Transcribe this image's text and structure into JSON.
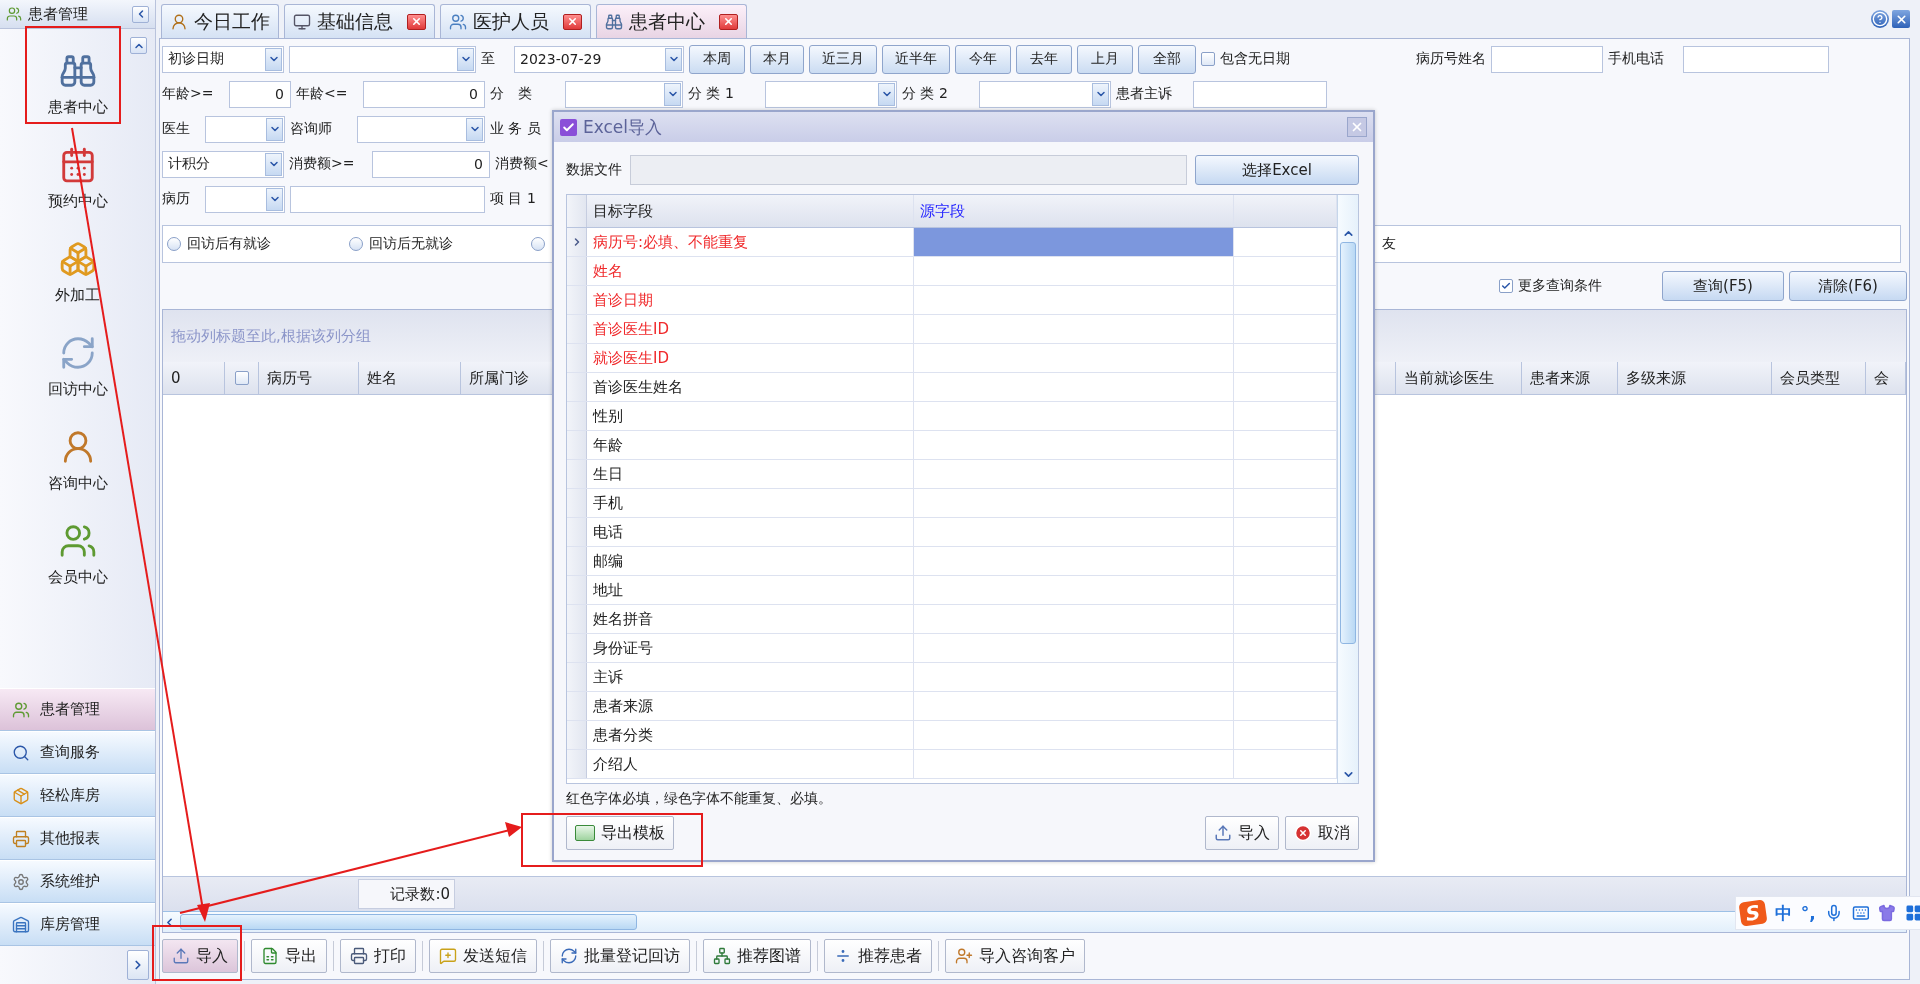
{
  "sidebar": {
    "title": "患者管理",
    "items": [
      {
        "label": "患者中心"
      },
      {
        "label": "预约中心"
      },
      {
        "label": "外加工"
      },
      {
        "label": "回访中心"
      },
      {
        "label": "咨询中心"
      },
      {
        "label": "会员中心"
      }
    ],
    "nav": [
      {
        "label": "患者管理",
        "selected": true
      },
      {
        "label": "查询服务",
        "selected": false
      },
      {
        "label": "轻松库房",
        "selected": false
      },
      {
        "label": "其他报表",
        "selected": false
      },
      {
        "label": "系统维护",
        "selected": false
      },
      {
        "label": "库房管理",
        "selected": false
      }
    ]
  },
  "tabs": [
    {
      "label": "今日工作",
      "selected": false,
      "closable": false
    },
    {
      "label": "基础信息",
      "selected": false,
      "closable": true
    },
    {
      "label": "医护人员",
      "selected": false,
      "closable": true
    },
    {
      "label": "患者中心",
      "selected": true,
      "closable": true
    }
  ],
  "filters": [
    [
      {
        "kind": "select",
        "value": "初诊日期"
      },
      {
        "kind": "select"
      },
      {
        "kind": "label",
        "text": "至"
      },
      {
        "kind": "select",
        "value": "2023-07-29"
      },
      {
        "kind": "button",
        "text": "本周"
      },
      {
        "kind": "button",
        "text": "本月"
      },
      {
        "kind": "button",
        "text": "近三月"
      },
      {
        "kind": "button",
        "text": "近半年"
      },
      {
        "kind": "button",
        "text": "今年"
      },
      {
        "kind": "button",
        "text": "去年"
      },
      {
        "kind": "button",
        "text": "上月"
      },
      {
        "kind": "button",
        "text": "全部"
      },
      {
        "kind": "checkbox",
        "text": "包含无日期",
        "checked": false
      },
      {
        "kind": "label",
        "text": "病历号姓名"
      },
      {
        "kind": "input"
      },
      {
        "kind": "label",
        "text": "手机电话"
      },
      {
        "kind": "input"
      }
    ],
    [
      {
        "kind": "label",
        "text": "年龄>="
      },
      {
        "kind": "number",
        "value": "0"
      },
      {
        "kind": "label",
        "text": "年龄<="
      },
      {
        "kind": "number",
        "value": "0"
      },
      {
        "kind": "label",
        "text": "分　类"
      },
      {
        "kind": "select"
      },
      {
        "kind": "label",
        "text": "分 类 1"
      },
      {
        "kind": "select"
      },
      {
        "kind": "label",
        "text": "分 类 2"
      },
      {
        "kind": "select"
      },
      {
        "kind": "label",
        "text": "患者主诉"
      },
      {
        "kind": "input"
      }
    ],
    [
      {
        "kind": "label",
        "text": "医生"
      },
      {
        "kind": "select"
      },
      {
        "kind": "label",
        "text": "咨询师"
      },
      {
        "kind": "select"
      },
      {
        "kind": "label",
        "text": "业 务 员"
      }
    ],
    [
      {
        "kind": "select",
        "value": "计积分"
      },
      {
        "kind": "label",
        "text": "消费额>="
      },
      {
        "kind": "number",
        "value": "0"
      },
      {
        "kind": "label",
        "text": "消费额<"
      }
    ],
    [
      {
        "kind": "label",
        "text": "病历"
      },
      {
        "kind": "select"
      },
      {
        "kind": "input"
      },
      {
        "kind": "label",
        "text": "项 目 1"
      }
    ]
  ],
  "radios": [
    {
      "label": "回访后有就诊",
      "selected": false
    },
    {
      "label": "回访后无就诊",
      "selected": false
    },
    {
      "selected": false
    }
  ],
  "radio_tail": "友",
  "more_conditions": {
    "label": "更多查询条件",
    "checked": true
  },
  "search_buttons": [
    "查询(F5)",
    "清除(F6)"
  ],
  "grid": {
    "group_hint": "拖动列标题至此,根据该列分组",
    "columns": [
      {
        "label": "0"
      },
      {
        "kind": "checkbox",
        "checked": false
      },
      {
        "label": "病历号"
      },
      {
        "label": "姓名"
      },
      {
        "label": "所属门诊"
      },
      {
        "label": "当前就诊医生"
      },
      {
        "label": "患者来源"
      },
      {
        "label": "多级来源"
      },
      {
        "label": "会员类型"
      },
      {
        "label": "会"
      }
    ],
    "record_count": "记录数:0"
  },
  "toolbar": [
    {
      "label": "导入",
      "selected": true
    },
    {
      "label": "导出",
      "selected": false
    },
    {
      "label": "打印",
      "selected": false
    },
    {
      "label": "发送短信",
      "selected": false
    },
    {
      "label": "批量登记回访",
      "selected": false
    },
    {
      "label": "推荐图谱",
      "selected": false
    },
    {
      "label": "推荐患者",
      "selected": false
    },
    {
      "label": "导入咨询客户",
      "selected": false
    }
  ],
  "dialog": {
    "title": "Excel导入",
    "file_label": "数据文件",
    "choose_button": "选择Excel",
    "columns": [
      "目标字段",
      "源字段"
    ],
    "rows": [
      {
        "field": "病历号:必填、不能重复",
        "required": true,
        "selected": true
      },
      {
        "field": "姓名",
        "required": true,
        "selected": false
      },
      {
        "field": "首诊日期",
        "required": true,
        "selected": false
      },
      {
        "field": "首诊医生ID",
        "required": true,
        "selected": false
      },
      {
        "field": "就诊医生ID",
        "required": true,
        "selected": false
      },
      {
        "field": "首诊医生姓名",
        "required": false,
        "selected": false
      },
      {
        "field": "性别",
        "required": false,
        "selected": false
      },
      {
        "field": "年龄",
        "required": false,
        "selected": false
      },
      {
        "field": "生日",
        "required": false,
        "selected": false
      },
      {
        "field": "手机",
        "required": false,
        "selected": false
      },
      {
        "field": "电话",
        "required": false,
        "selected": false
      },
      {
        "field": "邮编",
        "required": false,
        "selected": false
      },
      {
        "field": "地址",
        "required": false,
        "selected": false
      },
      {
        "field": "姓名拼音",
        "required": false,
        "selected": false
      },
      {
        "field": "身份证号",
        "required": false,
        "selected": false
      },
      {
        "field": "主诉",
        "required": false,
        "selected": false
      },
      {
        "field": "患者来源",
        "required": false,
        "selected": false
      },
      {
        "field": "患者分类",
        "required": false,
        "selected": false
      },
      {
        "field": "介绍人",
        "required": false,
        "selected": false
      }
    ],
    "note": "红色字体必填，绿色字体不能重复、必填。",
    "export_button": "导出模板",
    "import_button": "导入",
    "cancel_button": "取消"
  },
  "ime": {
    "logo": "S",
    "lang": "中",
    "punct": "°,"
  }
}
